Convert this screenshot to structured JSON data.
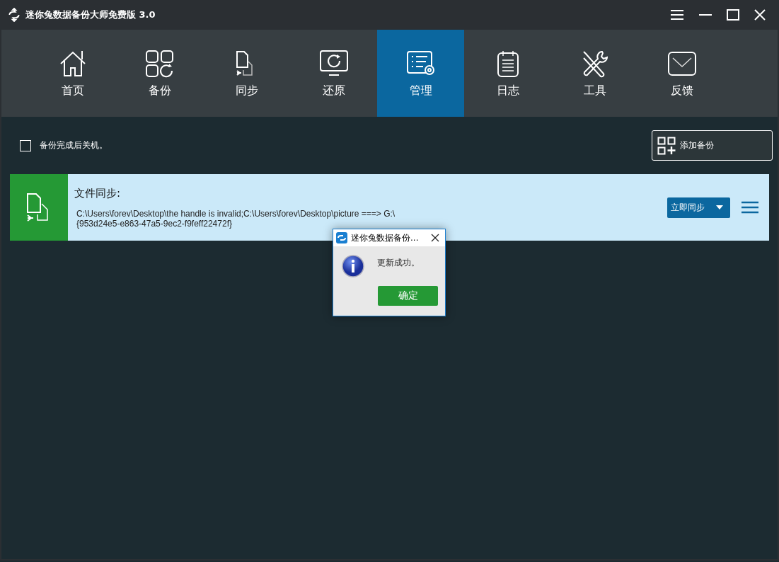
{
  "window": {
    "title": "迷你兔数据备份大师免费版 3.0"
  },
  "nav_tabs": [
    {
      "label": "首页",
      "kind": "home",
      "selected": false
    },
    {
      "label": "备份",
      "kind": "backup",
      "selected": false
    },
    {
      "label": "同步",
      "kind": "sync",
      "selected": false
    },
    {
      "label": "还原",
      "kind": "restore",
      "selected": false
    },
    {
      "label": "管理",
      "kind": "manage",
      "selected": true
    },
    {
      "label": "日志",
      "kind": "log",
      "selected": false
    },
    {
      "label": "工具",
      "kind": "tools",
      "selected": false
    },
    {
      "label": "反馈",
      "kind": "feedback",
      "selected": false
    }
  ],
  "shutdown_option": {
    "label": "备份完成后关机。",
    "checked": false
  },
  "add_backup_button": "添加备份",
  "tasks": [
    {
      "title": "文件同步:",
      "path": "C:\\Users\\forev\\Desktop\\the handle is invalid;C:\\Users\\forev\\Desktop\\picture ===> G:\\{953d24e5-e863-47a5-9ec2-f9feff22472f}",
      "action": "立即同步"
    }
  ],
  "dialog": {
    "title": "迷你兔数据备份...",
    "message": "更新成功。",
    "button": "确定"
  }
}
